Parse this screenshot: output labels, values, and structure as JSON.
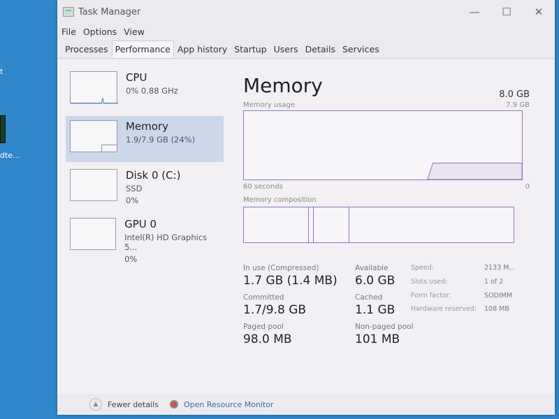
{
  "desktop": {
    "label_top": "t",
    "label_mid": "dte..."
  },
  "window": {
    "title": "Task Manager",
    "minimize": "—",
    "maximize": "☐",
    "close": "✕"
  },
  "menu": [
    "File",
    "Options",
    "View"
  ],
  "tabs": [
    "Processes",
    "Performance",
    "App history",
    "Startup",
    "Users",
    "Details",
    "Services"
  ],
  "active_tab": "Performance",
  "sidebar": [
    {
      "name": "CPU",
      "line1": "0% 0.88 GHz",
      "line2": ""
    },
    {
      "name": "Memory",
      "line1": "1.9/7.9 GB (24%)",
      "line2": ""
    },
    {
      "name": "Disk 0 (C:)",
      "line1": "SSD",
      "line2": "0%"
    },
    {
      "name": "GPU 0",
      "line1": "Intel(R) HD Graphics 5...",
      "line2": "0%"
    }
  ],
  "main": {
    "title": "Memory",
    "total": "8.0 GB",
    "usage_label": "Memory usage",
    "usage_max": "7.9 GB",
    "time_label": "60 seconds",
    "time_min": "0",
    "usage_fraction": 0.24,
    "composition_label": "Memory composition",
    "composition_fractions": {
      "in_use": 0.24,
      "modified": 0.02,
      "standby": 0.13,
      "free": 0.61
    },
    "stats": {
      "in_use_label": "In use (Compressed)",
      "in_use": "1.7 GB (1.4 MB)",
      "available_label": "Available",
      "available": "6.0 GB",
      "committed_label": "Committed",
      "committed": "1.7/9.8 GB",
      "cached_label": "Cached",
      "cached": "1.1 GB",
      "paged_label": "Paged pool",
      "paged": "98.0 MB",
      "nonpaged_label": "Non-paged pool",
      "nonpaged": "101 MB"
    },
    "hardware": [
      {
        "k": "Speed:",
        "v": "2133 M..."
      },
      {
        "k": "Slots used:",
        "v": "1 of 2"
      },
      {
        "k": "Form factor:",
        "v": "SODIMM"
      },
      {
        "k": "Hardware reserved:",
        "v": "108 MB"
      }
    ]
  },
  "footer": {
    "fewer": "Fewer details",
    "monitor": "Open Resource Monitor"
  }
}
